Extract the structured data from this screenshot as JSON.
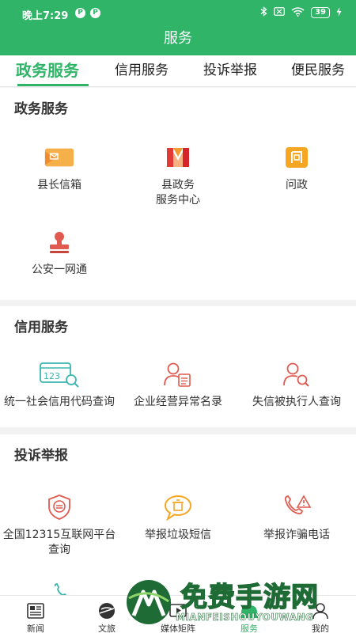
{
  "status_bar": {
    "time": "晚上7:29",
    "badges": [
      "P",
      "P"
    ],
    "battery": "39"
  },
  "title": "服务",
  "tabs": [
    {
      "label": "政务服务",
      "active": true
    },
    {
      "label": "信用服务",
      "active": false
    },
    {
      "label": "投诉举报",
      "active": false
    },
    {
      "label": "便民服务",
      "active": false
    }
  ],
  "sections": [
    {
      "title": "政务服务",
      "items": [
        {
          "label": "县长信箱",
          "icon": "mailbox-icon"
        },
        {
          "label": "县政务\n服务中心",
          "icon": "government-center-icon"
        },
        {
          "label": "问政",
          "icon": "inquiry-icon"
        },
        {
          "label": "公安一网通",
          "icon": "police-stamp-icon"
        }
      ]
    },
    {
      "title": "信用服务",
      "items": [
        {
          "label": "统一社会信用代码查询",
          "icon": "credit-code-search-icon"
        },
        {
          "label": "企业经营异常名录",
          "icon": "business-abnormal-list-icon"
        },
        {
          "label": "失信被执行人查询",
          "icon": "person-search-icon"
        }
      ]
    },
    {
      "title": "投诉举报",
      "items": [
        {
          "label": "全国12315互联网平台查询",
          "icon": "consumer-shield-icon"
        },
        {
          "label": "举报垃圾短信",
          "icon": "spam-sms-icon"
        },
        {
          "label": "举报诈骗电话",
          "icon": "fraud-call-icon"
        }
      ]
    }
  ],
  "bottom_nav": [
    {
      "label": "新闻",
      "icon": "news-icon",
      "active": false
    },
    {
      "label": "文旅",
      "icon": "travel-icon",
      "active": false
    },
    {
      "label": "媒体矩阵",
      "icon": "media-icon",
      "active": false
    },
    {
      "label": "服务",
      "icon": "service-icon",
      "active": true
    },
    {
      "label": "我的",
      "icon": "profile-icon",
      "active": false
    }
  ],
  "watermark": {
    "main": "免费手游网",
    "url": "MIANFEISHOUYOUWANG"
  },
  "colors": {
    "brand_green": "#2fb468",
    "accent_orange": "#f5a623",
    "accent_red": "#e05a4f",
    "accent_teal": "#3bb5b0"
  }
}
